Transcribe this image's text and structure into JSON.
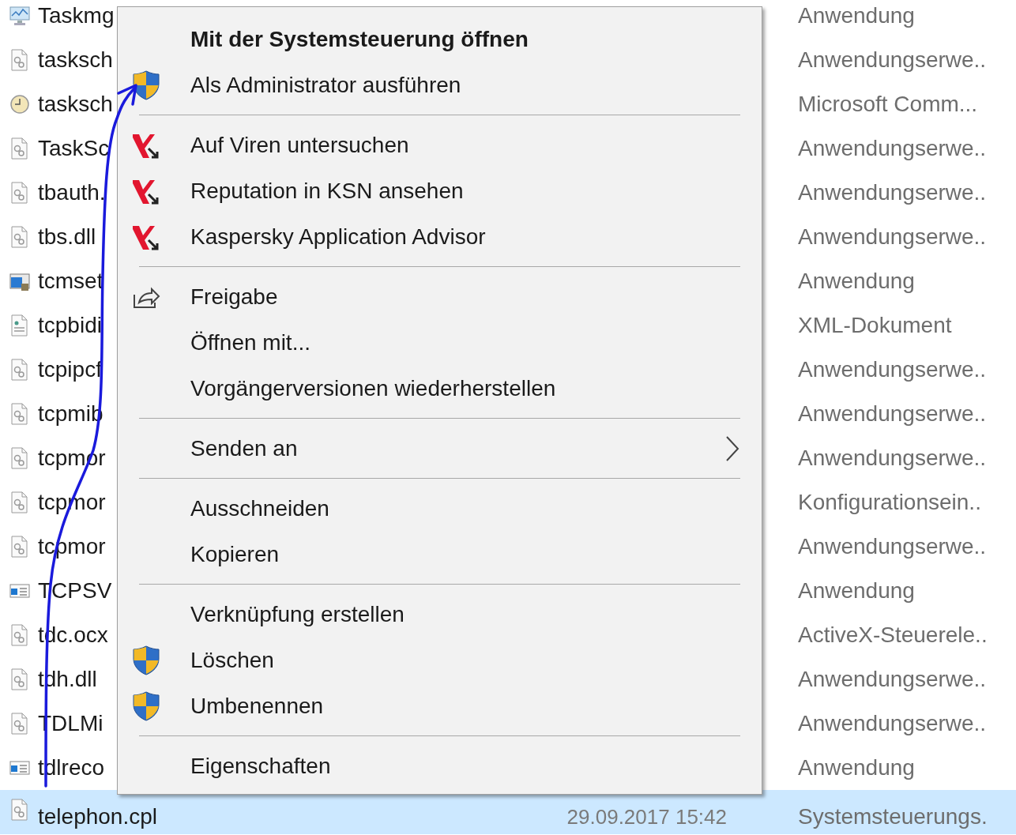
{
  "file_list": {
    "rows": [
      {
        "name": "Taskmg",
        "type": "Anwendung",
        "kind": "monitor",
        "selected": false
      },
      {
        "name": "tasksch",
        "type": "Anwendungserwe..",
        "kind": "settings-file",
        "selected": false
      },
      {
        "name": "tasksch",
        "type": "Microsoft Comm...",
        "kind": "clock",
        "selected": false
      },
      {
        "name": "TaskSc",
        "type": "Anwendungserwe..",
        "kind": "settings-file",
        "selected": false
      },
      {
        "name": "tbauth.",
        "type": "Anwendungserwe..",
        "kind": "settings-file",
        "selected": false
      },
      {
        "name": "tbs.dll",
        "type": "Anwendungserwe..",
        "kind": "settings-file",
        "selected": false
      },
      {
        "name": "tcmset",
        "type": "Anwendung",
        "kind": "app",
        "selected": false
      },
      {
        "name": "tcpbidi",
        "type": "XML-Dokument",
        "kind": "text-file",
        "selected": false
      },
      {
        "name": "tcpipcf",
        "type": "Anwendungserwe..",
        "kind": "settings-file",
        "selected": false
      },
      {
        "name": "tcpmib",
        "type": "Anwendungserwe..",
        "kind": "settings-file",
        "selected": false
      },
      {
        "name": "tcpmor",
        "type": "Anwendungserwe..",
        "kind": "settings-file",
        "selected": false
      },
      {
        "name": "tcpmor",
        "type": "Konfigurationsein..",
        "kind": "settings-file",
        "selected": false
      },
      {
        "name": "tcpmor",
        "type": "Anwendungserwe..",
        "kind": "settings-file",
        "selected": false
      },
      {
        "name": "TCPSV",
        "type": "Anwendung",
        "kind": "window",
        "selected": false
      },
      {
        "name": "tdc.ocx",
        "type": "ActiveX-Steuerele..",
        "kind": "settings-file",
        "selected": false
      },
      {
        "name": "tdh.dll",
        "type": "Anwendungserwe..",
        "kind": "settings-file",
        "selected": false
      },
      {
        "name": "TDLMi",
        "type": "Anwendungserwe..",
        "kind": "settings-file",
        "selected": false
      },
      {
        "name": "tdlreco",
        "type": "Anwendung",
        "kind": "window",
        "selected": false
      },
      {
        "name": "telephon.cpl",
        "date": "29.09.2017 15:42",
        "type": "Systemsteuerungs.",
        "kind": "settings-file",
        "selected": true
      }
    ]
  },
  "context_menu": {
    "items": [
      {
        "kind": "item",
        "label": "Mit der Systemsteuerung öffnen",
        "bold": true
      },
      {
        "kind": "shield",
        "label": "Als Administrator ausführen"
      },
      {
        "kind": "separator"
      },
      {
        "kind": "kaspersky",
        "label": "Auf Viren untersuchen"
      },
      {
        "kind": "kaspersky",
        "label": "Reputation in KSN ansehen"
      },
      {
        "kind": "kaspersky",
        "label": "Kaspersky Application Advisor"
      },
      {
        "kind": "separator"
      },
      {
        "kind": "share",
        "label": "Freigabe"
      },
      {
        "kind": "item",
        "label": "Öffnen mit..."
      },
      {
        "kind": "item",
        "label": "Vorgängerversionen wiederherstellen"
      },
      {
        "kind": "separator"
      },
      {
        "kind": "item",
        "label": "Senden an",
        "submenu": true
      },
      {
        "kind": "separator"
      },
      {
        "kind": "item",
        "label": "Ausschneiden"
      },
      {
        "kind": "item",
        "label": "Kopieren"
      },
      {
        "kind": "separator"
      },
      {
        "kind": "item",
        "label": "Verknüpfung erstellen"
      },
      {
        "kind": "shield",
        "label": "Löschen"
      },
      {
        "kind": "shield",
        "label": "Umbenennen"
      },
      {
        "kind": "separator"
      },
      {
        "kind": "item",
        "label": "Eigenschaften"
      }
    ]
  },
  "annotation": {
    "kind": "arrow"
  }
}
